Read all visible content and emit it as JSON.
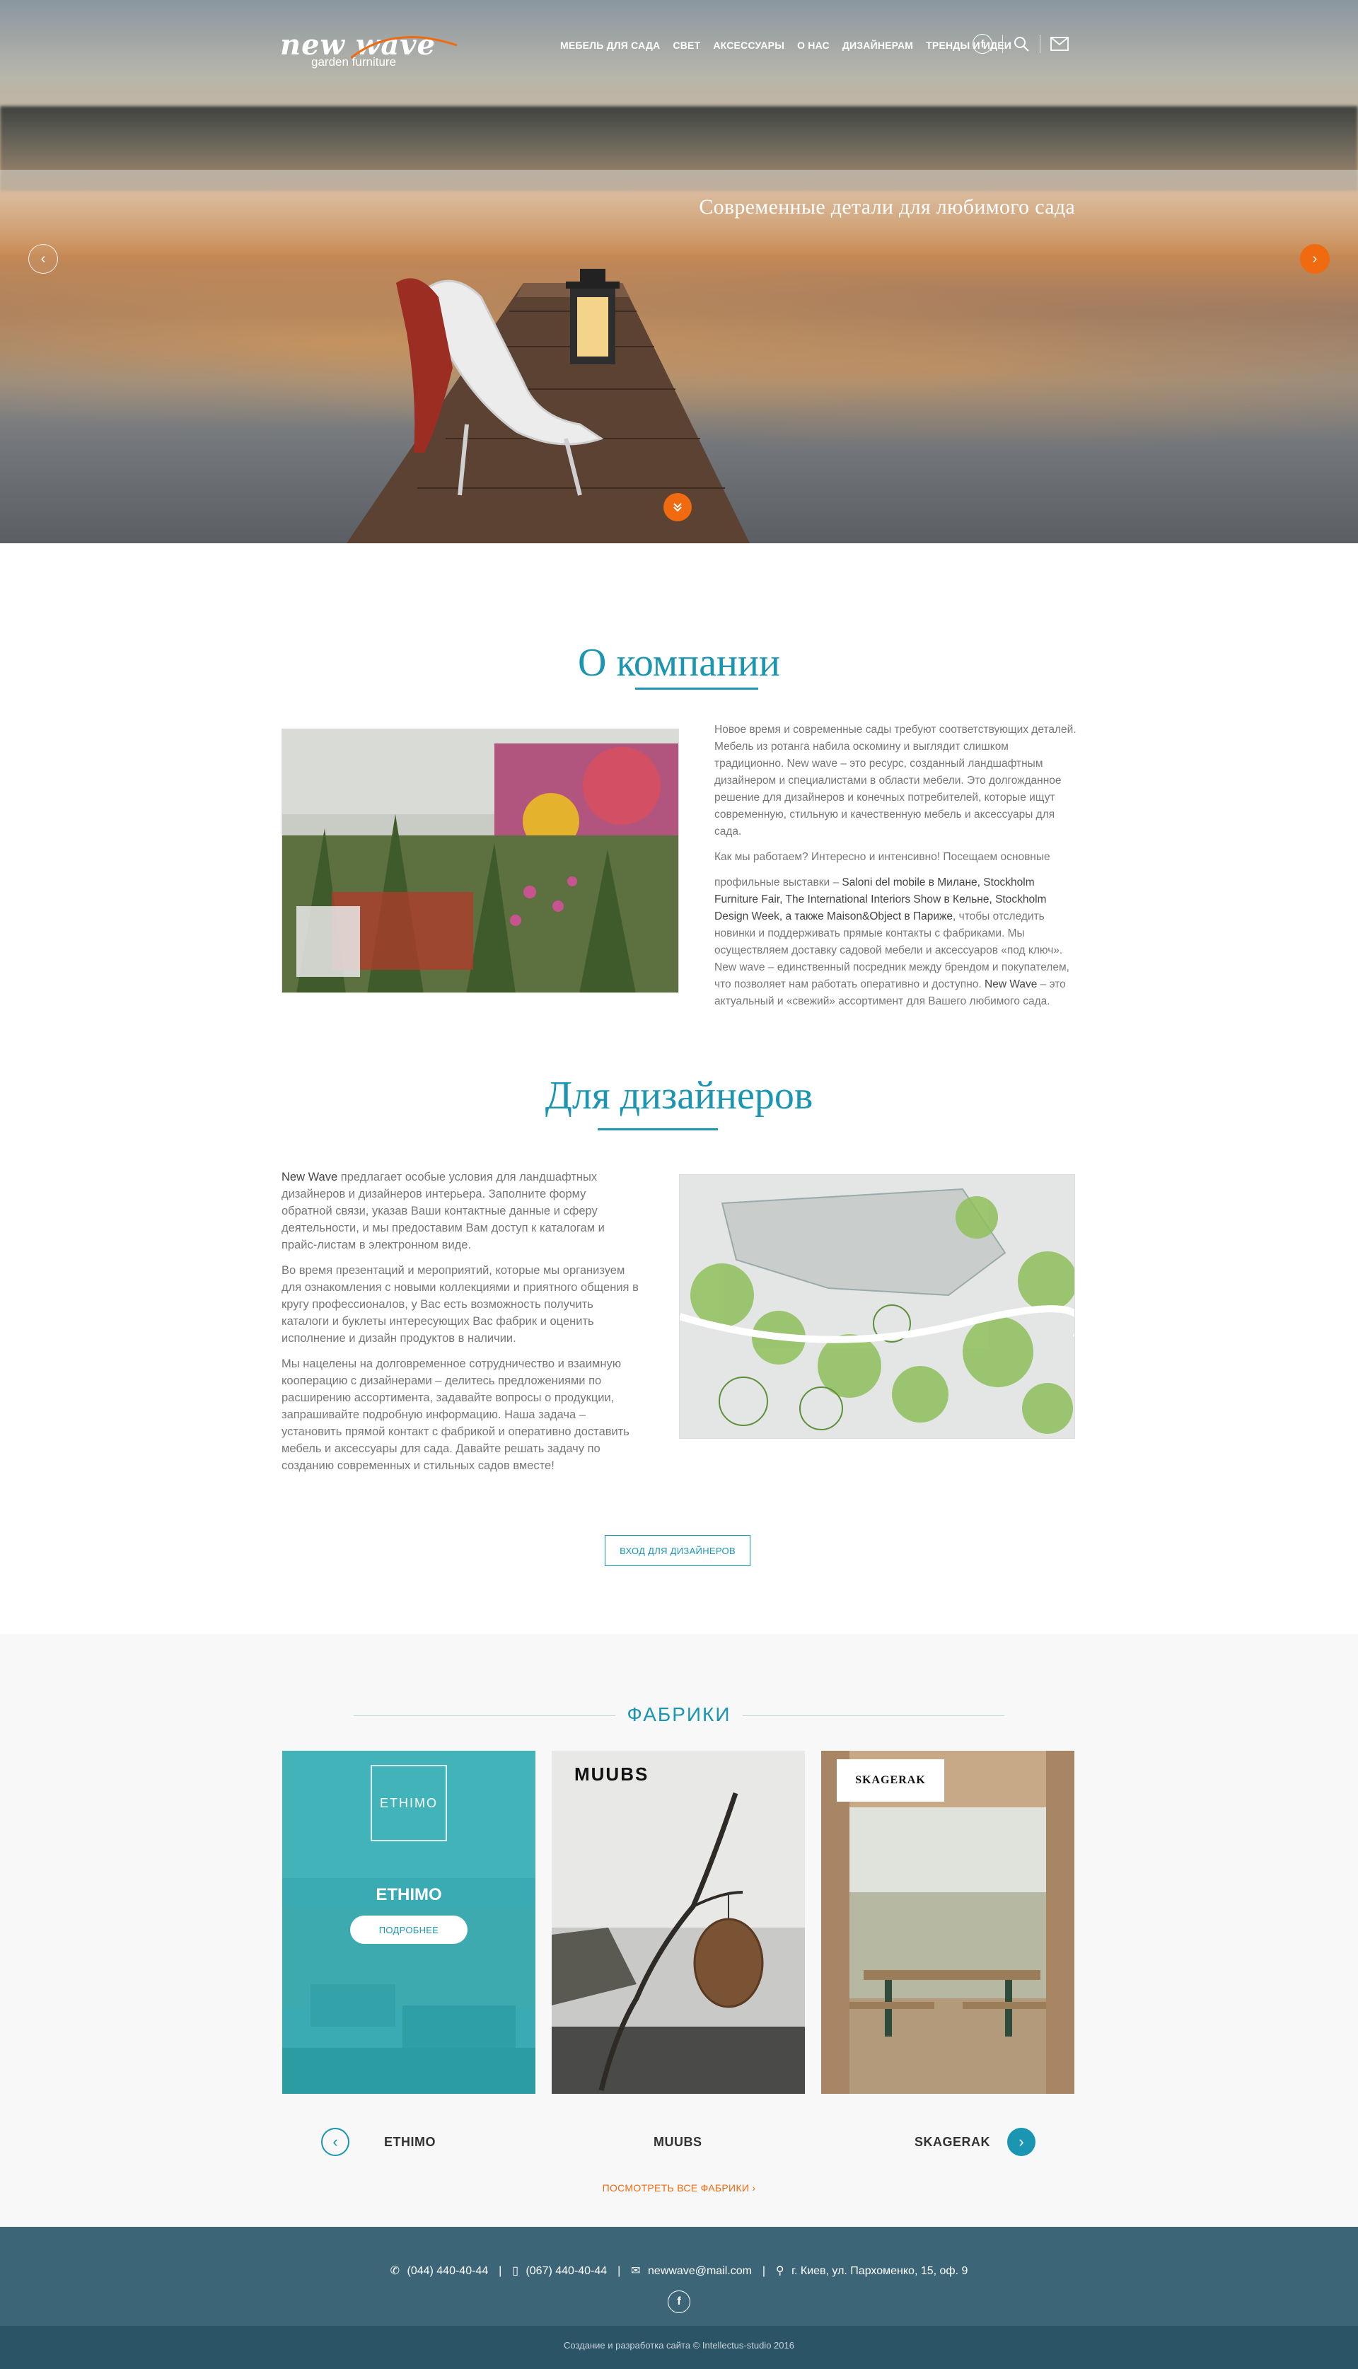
{
  "header": {
    "logo_main": "new wave",
    "logo_sub": "garden furniture",
    "menu": [
      {
        "label": "МЕБЕЛЬ ДЛЯ САДА"
      },
      {
        "label": "СВЕТ"
      },
      {
        "label": "АКСЕССУАРЫ"
      },
      {
        "label": "О НАС"
      },
      {
        "label": "ДИЗАЙНЕРАМ"
      },
      {
        "label": "ТРЕНДЫ И ИДЕИ"
      }
    ],
    "icons": [
      "facebook-icon",
      "search-icon",
      "mail-icon"
    ]
  },
  "hero": {
    "slogan": "Современные детали для любимого сада",
    "prev_icon": "chevron-left-icon",
    "next_icon": "chevron-right-icon",
    "scroll_icon": "chevron-down-icon"
  },
  "about": {
    "title": "О компании",
    "p1": "Новое время и современные сады требуют соответствующих деталей. Мебель из ротанга набила оскомину и выглядит слишком традиционно. New wave – это ресурс, созданный ландшафтным дизайнером и специалистами в области мебели. Это долгожданное решение для дизайнеров и конечных потребителей, которые ищут современную, стильную и качественную мебель и аксессуары для сада.",
    "p2": "Как мы работаем? Интересно и интенсивно! Посещаем основные",
    "p3_start": "профильные выставки – ",
    "p3_bold": "Saloni del mobile в Милане, Stockholm Furniture Fair, The International Interiors Show в Кельне, Stockholm Design Week, а также Maison&Object в Париже",
    "p3_end": ", чтобы отследить новинки и поддерживать прямые контакты с фабриками. Мы осуществляем доставку садовой мебели и аксессуаров «под ключ». New wave – единственный посредник между брендом и покупателем, что позволяет нам работать оперативно и доступно. ",
    "p3_brand": "New Wave",
    "p3_tail": " – это актуальный и «свежий» ассортимент для Вашего любимого сада."
  },
  "designers": {
    "title": "Для дизайнеров",
    "p1_brand": "New Wave",
    "p1": " предлагает особые условия для ландшафтных дизайнеров и дизайнеров интерьера. Заполните форму обратной связи, указав Ваши контактные данные и сферу деятельности, и мы предоставим Вам доступ к каталогам и прайс-листам в электронном виде.",
    "p2": "Во время презентаций и мероприятий, которые мы организуем для ознакомления с новыми коллекциями и приятного общения в кругу профессионалов, у Вас есть возможность получить каталоги и буклеты интересующих Вас фабрик и оценить исполнение и дизайн продуктов в наличии.",
    "p3": "Мы нацелены на долговременное сотрудничество и взаимную кооперацию с дизайнерами – делитесь предложениями по расширению ассортимента, задавайте вопросы о продукции, запрашивайте подробную информацию. Наша задача – установить прямой контакт с фабрикой и оперативно доставить мебель и аксессуары для сада. Давайте решать задачу по созданию современных и стильных садов вместе!",
    "button": "ВХОД ДЛЯ ДИЗАЙНЕРОВ"
  },
  "factories": {
    "title": "ФАБРИКИ",
    "cards": [
      {
        "name": "ETHIMO",
        "logo": "ETHIMO",
        "button": "ПОДРОБНЕЕ"
      },
      {
        "name": "MUUBS",
        "logo": "MUUBS"
      },
      {
        "name": "SKAGERAK",
        "logo": "SKAGERAK"
      }
    ],
    "carousel": [
      "ETHIMO",
      "MUUBS",
      "SKAGERAK"
    ],
    "see_all": "ПОСМОТРЕТЬ ВСЕ ФАБРИКИ ›",
    "accent": "#1a95b2"
  },
  "footer": {
    "phone1": "(044) 440-40-44",
    "phone2": "(067) 440-40-44",
    "email": "newwave@mail.com",
    "address": "г. Киев, ул. Пархоменко, 15, оф. 9",
    "copyright": "Создание и разработка сайта © Intellectus-studio 2016"
  }
}
